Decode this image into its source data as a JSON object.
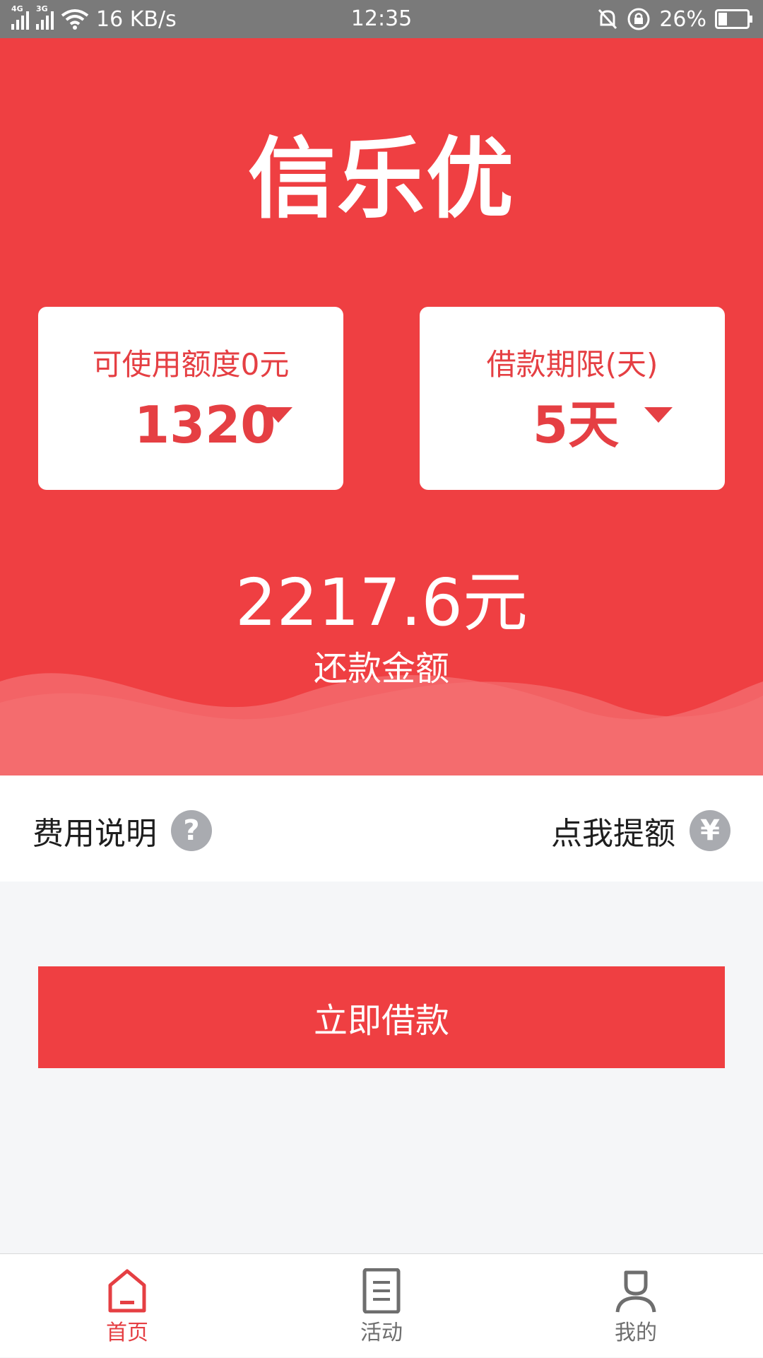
{
  "status_bar": {
    "network1": "4G",
    "network2": "3G",
    "speed": "16 KB/s",
    "time": "12:35",
    "battery": "26%"
  },
  "brand": {
    "name": "信乐优"
  },
  "amount_card": {
    "title": "可使用额度0元",
    "value": "1320"
  },
  "term_card": {
    "title": "借款期限(天)",
    "value": "5天"
  },
  "repayment": {
    "amount": "2217.6元",
    "label": "还款金额"
  },
  "info": {
    "fee_label": "费用说明",
    "fee_icon": "question-icon",
    "raise_label": "点我提额",
    "raise_icon": "yuan-icon",
    "raise_icon_glyph": "¥",
    "fee_icon_glyph": "?"
  },
  "borrow_button": {
    "label": "立即借款"
  },
  "tabbar": {
    "items": [
      {
        "label": "首页",
        "icon": "home-icon",
        "active": true
      },
      {
        "label": "活动",
        "icon": "document-icon",
        "active": false
      },
      {
        "label": "我的",
        "icon": "user-icon",
        "active": false
      }
    ]
  },
  "colors": {
    "brand_red": "#ef3f42",
    "text_red": "#e53f43",
    "icon_grey": "#a9abb0"
  }
}
